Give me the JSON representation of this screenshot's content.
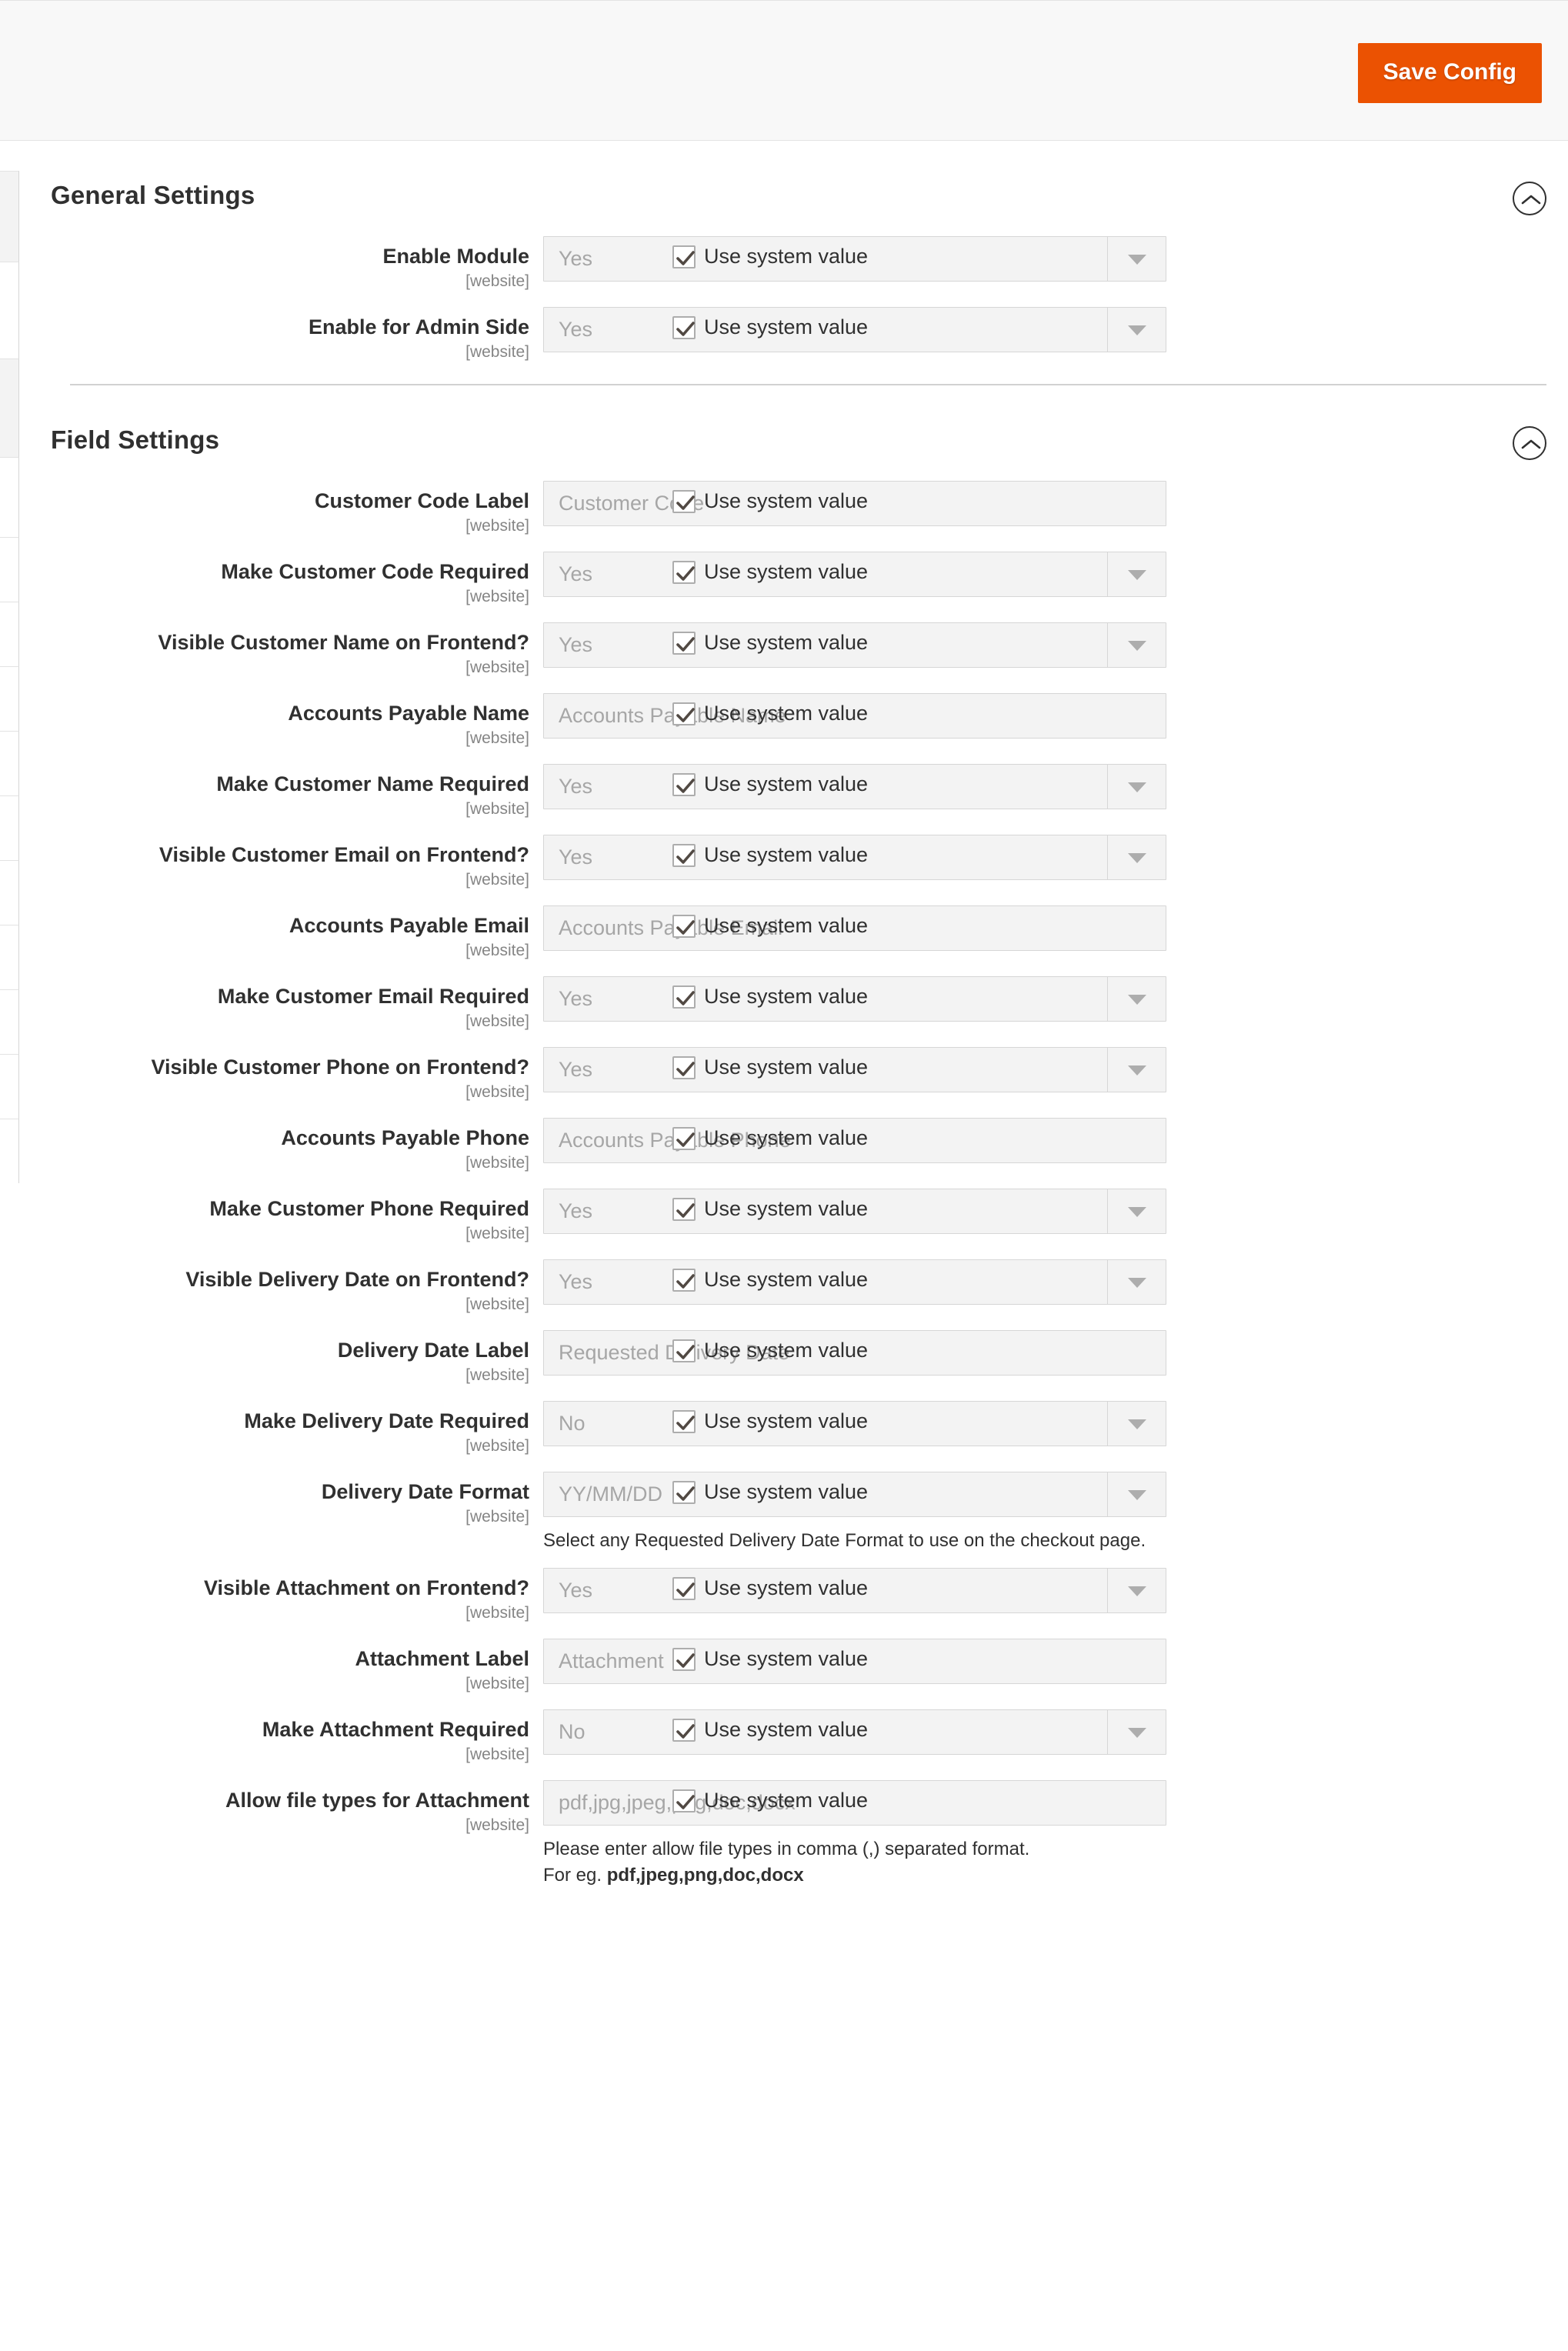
{
  "header": {
    "save_label": "Save Config"
  },
  "icons": {
    "collapse": "chevron-up-icon",
    "select_arrow": "chevron-down-icon",
    "checkbox_check": "check-icon"
  },
  "colors": {
    "accent": "#eb5202",
    "text": "#303030",
    "muted": "#858585",
    "placeholder": "#a6a6a6",
    "field_bg": "#f3f3f3",
    "field_border": "#d6d6d6"
  },
  "common": {
    "scope": "[website]",
    "use_system_value": "Use system value"
  },
  "sections": [
    {
      "id": "general-settings",
      "title": "General Settings",
      "fields": [
        {
          "label": "Enable Module",
          "scope": "[website]",
          "type": "select",
          "value": "Yes",
          "use_system": "Use system value"
        },
        {
          "label": "Enable for Admin Side",
          "scope": "[website]",
          "type": "select",
          "value": "Yes",
          "use_system": "Use system value"
        }
      ]
    },
    {
      "id": "field-settings",
      "title": "Field Settings",
      "fields": [
        {
          "label": "Customer Code Label",
          "scope": "[website]",
          "type": "text",
          "placeholder": "Customer Code",
          "value": "",
          "use_system": "Use system value"
        },
        {
          "label": "Make Customer Code Required",
          "scope": "[website]",
          "type": "select",
          "value": "Yes",
          "use_system": "Use system value"
        },
        {
          "label": "Visible Customer Name on Frontend?",
          "scope": "[website]",
          "type": "select",
          "value": "Yes",
          "use_system": "Use system value"
        },
        {
          "label": "Accounts Payable Name",
          "scope": "[website]",
          "type": "text",
          "placeholder": "Accounts Payable Name",
          "value": "",
          "use_system": "Use system value"
        },
        {
          "label": "Make Customer Name Required",
          "scope": "[website]",
          "type": "select",
          "value": "Yes",
          "use_system": "Use system value"
        },
        {
          "label": "Visible Customer Email on Frontend?",
          "scope": "[website]",
          "type": "select",
          "value": "Yes",
          "use_system": "Use system value"
        },
        {
          "label": "Accounts Payable Email",
          "scope": "[website]",
          "type": "text",
          "placeholder": "Accounts Payable Email",
          "value": "",
          "use_system": "Use system value"
        },
        {
          "label": "Make Customer Email Required",
          "scope": "[website]",
          "type": "select",
          "value": "Yes",
          "use_system": "Use system value"
        },
        {
          "label": "Visible Customer Phone on Frontend?",
          "scope": "[website]",
          "type": "select",
          "value": "Yes",
          "use_system": "Use system value"
        },
        {
          "label": "Accounts Payable Phone",
          "scope": "[website]",
          "type": "text",
          "placeholder": "Accounts Payable Phone",
          "value": "",
          "use_system": "Use system value"
        },
        {
          "label": "Make Customer Phone Required",
          "scope": "[website]",
          "type": "select",
          "value": "Yes",
          "use_system": "Use system value"
        },
        {
          "label": "Visible Delivery Date on Frontend?",
          "scope": "[website]",
          "type": "select",
          "value": "Yes",
          "use_system": "Use system value"
        },
        {
          "label": "Delivery Date Label",
          "scope": "[website]",
          "type": "text",
          "placeholder": "Requested Delivery Date",
          "value": "",
          "use_system": "Use system value"
        },
        {
          "label": "Make Delivery Date Required",
          "scope": "[website]",
          "type": "select",
          "value": "No",
          "use_system": "Use system value"
        },
        {
          "label": "Delivery Date Format",
          "scope": "[website]",
          "type": "select",
          "value": "YY/MM/DD",
          "use_system": "Use system value",
          "note": "Select any Requested Delivery Date Format to use on the checkout page."
        },
        {
          "label": "Visible Attachment on Frontend?",
          "scope": "[website]",
          "type": "select",
          "value": "Yes",
          "use_system": "Use system value"
        },
        {
          "label": "Attachment Label",
          "scope": "[website]",
          "type": "text",
          "placeholder": "Attachment",
          "value": "",
          "use_system": "Use system value"
        },
        {
          "label": "Make Attachment Required",
          "scope": "[website]",
          "type": "select",
          "value": "No",
          "use_system": "Use system value"
        },
        {
          "label": "Allow file types for Attachment",
          "scope": "[website]",
          "type": "text",
          "placeholder": "pdf,jpg,jpeg,png,doc,docx",
          "value": "",
          "use_system": "Use system value",
          "note": "Please enter allow file types in comma (,) separated format.",
          "note_line2_prefix": "For eg. ",
          "note_line2_bold": "pdf,jpeg,png,doc,docx"
        }
      ]
    }
  ]
}
